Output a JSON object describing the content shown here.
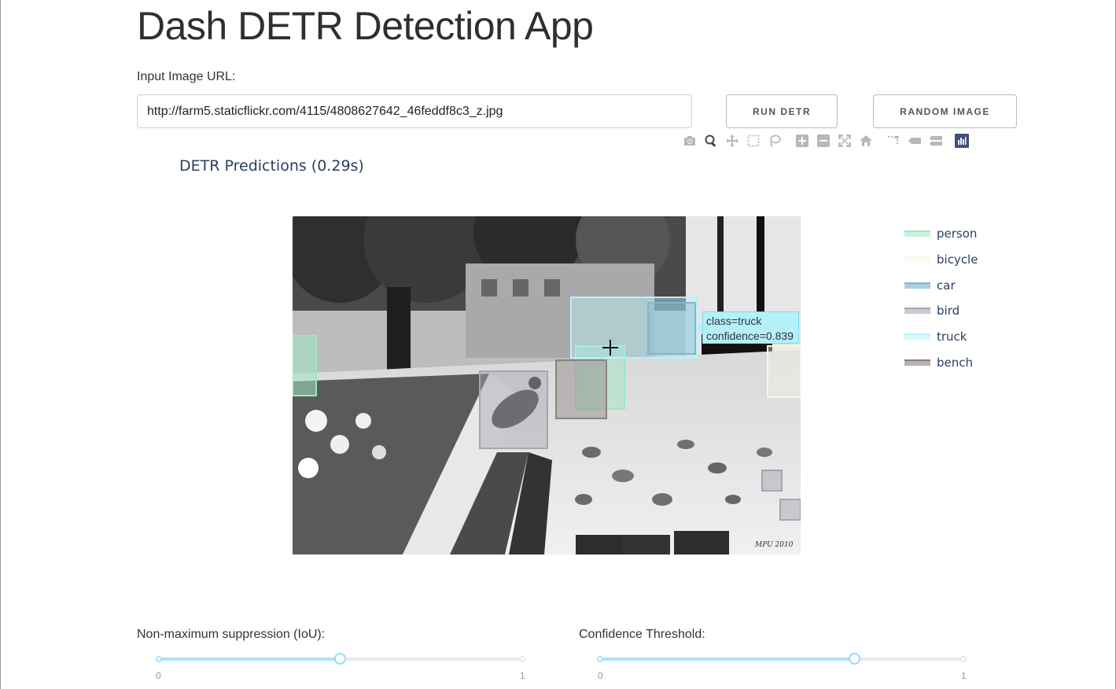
{
  "app": {
    "title": "Dash DETR Detection App",
    "url_label": "Input Image URL:",
    "url_value": "http://farm5.staticflickr.com/4115/4808627642_46feddf8c3_z.jpg",
    "run_button": "RUN DETR",
    "random_button": "RANDOM IMAGE"
  },
  "modebar": {
    "icons": [
      "camera-icon",
      "zoom-icon",
      "pan-icon",
      "box-select-icon",
      "lasso-select-icon",
      "zoom-in-icon",
      "zoom-out-icon",
      "autoscale-icon",
      "reset-axes-icon",
      "spike-lines-icon",
      "hover-closest-icon",
      "hover-compare-icon",
      "plotly-logo-icon"
    ],
    "active": "zoom-icon"
  },
  "plot": {
    "title": "DETR Predictions (0.29s)",
    "legend": [
      {
        "label": "person",
        "color": "#9ee6c4"
      },
      {
        "label": "bicycle",
        "color": "#f4f7e6"
      },
      {
        "label": "car",
        "color": "#7fb6cf"
      },
      {
        "label": "bird",
        "color": "#a9a3b3"
      },
      {
        "label": "truck",
        "color": "#b9f2fb"
      },
      {
        "label": "bench",
        "color": "#8c8282"
      }
    ],
    "tooltip": {
      "line1": "class=truck",
      "line2": "confidence=0.839"
    }
  },
  "sliders": {
    "nms": {
      "label": "Non-maximum suppression (IoU):",
      "min": "0",
      "max": "1",
      "value": 0.5
    },
    "confidence": {
      "label": "Confidence Threshold:",
      "min": "0",
      "max": "1",
      "value": 0.7
    }
  }
}
